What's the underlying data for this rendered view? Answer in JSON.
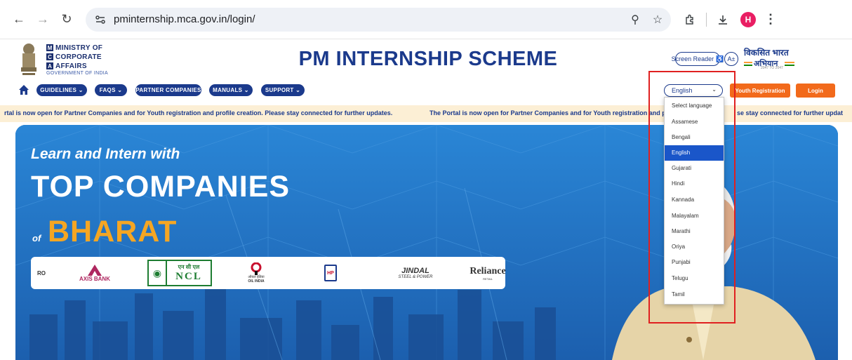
{
  "browser": {
    "url": "pminternship.mca.gov.in/login/",
    "profile_initial": "H"
  },
  "header": {
    "ministry_lines": [
      {
        "letter": "M",
        "text": "MINISTRY OF"
      },
      {
        "letter": "C",
        "text": "CORPORATE"
      },
      {
        "letter": "A",
        "text": "AFFAIRS"
      }
    ],
    "government": "GOVERNMENT OF INDIA",
    "title": "PM INTERNSHIP SCHEME",
    "screen_reader_label": "Screen Reader",
    "font_size_label": "A±",
    "viksit_line1": "विकसित भारत",
    "viksit_line2": "अभियान",
    "viksit_years": "2047 TO 2047"
  },
  "nav": {
    "items": [
      {
        "label": "GUIDELINES",
        "has_dropdown": true
      },
      {
        "label": "FAQS",
        "has_dropdown": true
      },
      {
        "label": "PARTNER COMPANIES",
        "has_dropdown": false
      },
      {
        "label": "MANUALS",
        "has_dropdown": true
      },
      {
        "label": "SUPPORT",
        "has_dropdown": true
      }
    ],
    "language_selected": "English",
    "youth_registration": "Youth Registration",
    "login": "Login"
  },
  "marquee": {
    "left_text": "rtal is now open for Partner Companies and for Youth registration and profile creation. Please stay connected for further updates.",
    "right_text_a": "The Portal is now open for Partner Companies and for Youth registration and p",
    "right_text_b": "se stay connected for further updat"
  },
  "banner": {
    "line1": "Learn and Intern with",
    "line2": "TOP COMPANIES",
    "of": "of",
    "bharat": "BHARAT",
    "logos": [
      {
        "name": "RO",
        "sub": ""
      },
      {
        "name": "AXIS BANK",
        "sub": ""
      },
      {
        "name": "NCL",
        "sub": "एन सी एल"
      },
      {
        "name": "OIL INDIA",
        "sub": "ऑयल इंडिया"
      },
      {
        "name": "HP",
        "sub": ""
      },
      {
        "name": "JINDAL",
        "sub": "STEEL & POWER"
      },
      {
        "name": "Reliance",
        "sub": "RETAIL"
      }
    ]
  },
  "language_dropdown": {
    "options": [
      "Select language",
      "Assamese",
      "Bengali",
      "English",
      "Gujarati",
      "Hindi",
      "Kannada",
      "Malayalam",
      "Marathi",
      "Oriya",
      "Punjabi",
      "Telugu",
      "Tamil"
    ],
    "selected": "English"
  },
  "colors": {
    "brand_navy": "#1b3a8c",
    "accent_orange": "#f26a1b",
    "banner_blue": "#1e6fc2",
    "bharat_gold": "#f5a623",
    "highlight_red": "#e02020",
    "selected_option_blue": "#1a56c9"
  }
}
